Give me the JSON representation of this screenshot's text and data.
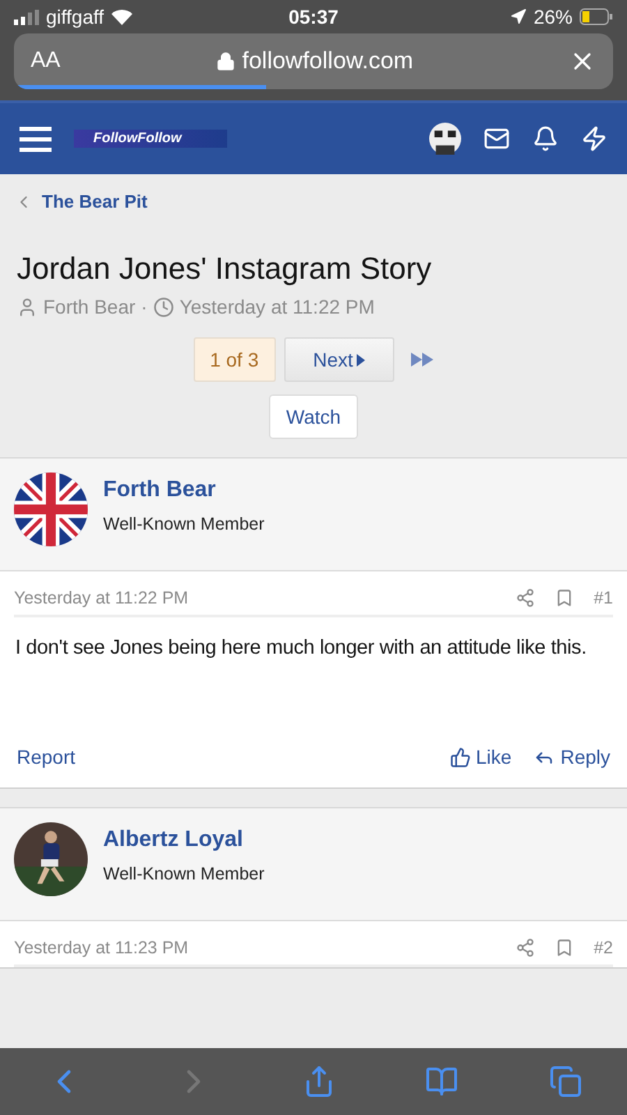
{
  "status_bar": {
    "carrier": "giffgaff",
    "time": "05:37",
    "battery": "26%"
  },
  "browser": {
    "text_size": "AA",
    "url": "followfollow.com",
    "level": 0.42
  },
  "header": {
    "logo_text": "FollowFollow"
  },
  "breadcrumb": "The Bear Pit",
  "thread": {
    "title": "Jordan Jones' Instagram Story",
    "author": "Forth Bear",
    "separator": "·",
    "date": "Yesterday at 11:22 PM"
  },
  "pagination": {
    "current": "1 of 3",
    "next": "Next"
  },
  "watch": "Watch",
  "posts": [
    {
      "author": "Forth Bear",
      "role": "Well-Known Member",
      "kind": "flag",
      "date": "Yesterday at 11:22 PM",
      "number": "#1",
      "body": "I don't see Jones being here much longer with an attitude like this.",
      "actions": {
        "report": "Report",
        "like": "Like",
        "reply": "Reply"
      }
    },
    {
      "author": "Albertz Loyal",
      "role": "Well-Known Member",
      "date": "Yesterday at 11:23 PM",
      "number": "#2"
    }
  ],
  "toolbar": {
    "back_disabled": false,
    "forward_disabled": true
  }
}
